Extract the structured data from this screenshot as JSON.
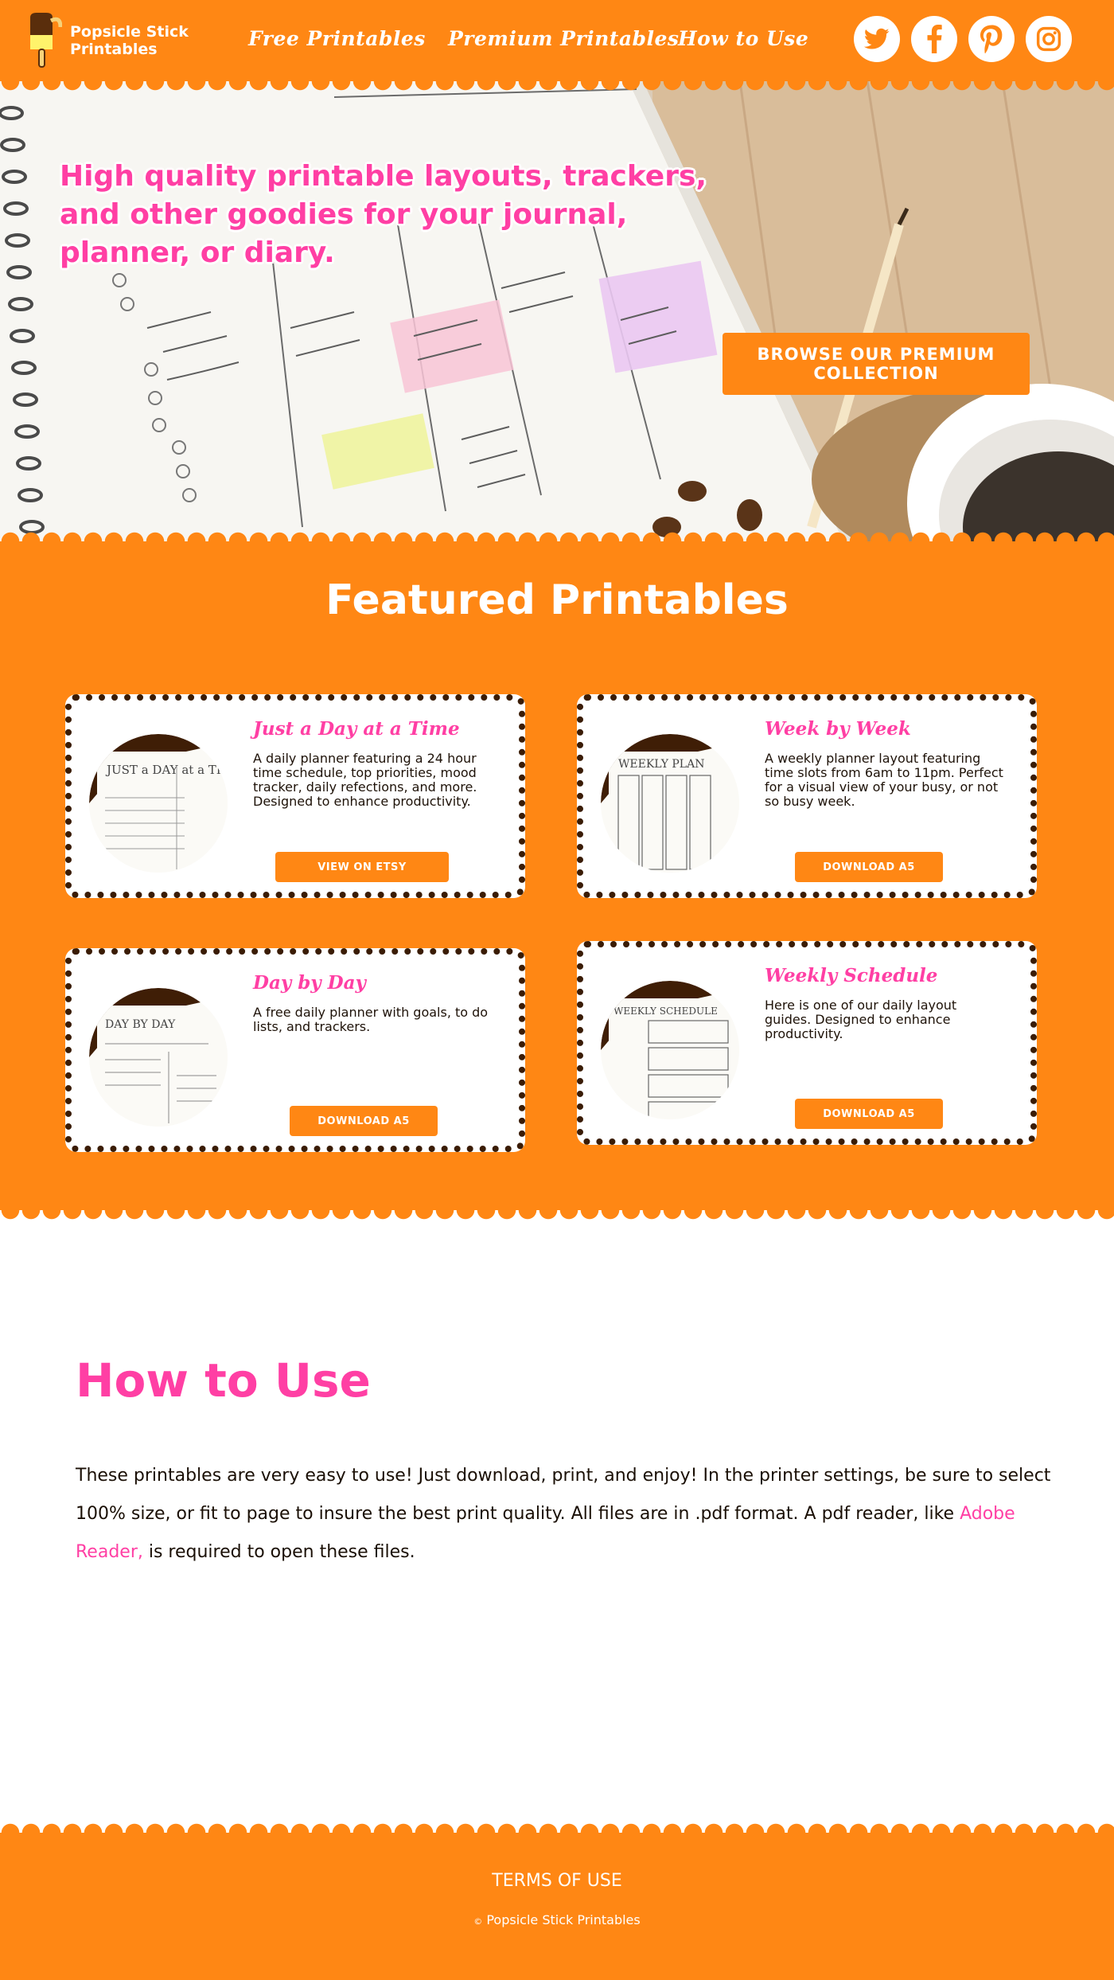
{
  "header": {
    "logo_line1": "Popsicle Stick",
    "logo_line2": "Printables",
    "nav": [
      "Free Printables",
      "Premium Printables",
      "How to Use"
    ],
    "social_icons": [
      "twitter-icon",
      "facebook-icon",
      "pinterest-icon",
      "instagram-icon"
    ]
  },
  "hero": {
    "title": "High quality printable layouts, trackers, and other goodies for your journal, planner, or diary.",
    "button": "BROWSE OUR PREMIUM COLLECTION"
  },
  "featured": {
    "title": "Featured Printables",
    "cards": [
      {
        "title": "Just a Day at a Time",
        "description": "A daily planner featuring a 24 hour time schedule, top priorities, mood tracker, daily refections, and more. Designed to enhance productivity.",
        "button": "VIEW ON ETSY",
        "thumb_label": "JUST a DAY at a TIME"
      },
      {
        "title": "Week by Week",
        "description": "A weekly planner layout featuring time slots from 6am to 11pm. Perfect for a visual view of your busy, or not so busy week.",
        "button": "DOWNLOAD A5",
        "thumb_label": "WEEKLY PLAN"
      },
      {
        "title": "Day by Day",
        "description": "A free daily planner with goals, to do lists, and trackers.",
        "button": "DOWNLOAD A5",
        "thumb_label": "DAY BY DAY"
      },
      {
        "title": "Weekly  Schedule",
        "description": "Here is one of our daily layout guides. Designed to enhance productivity.",
        "button": "DOWNLOAD A5",
        "thumb_label": "WEEKLY SCHEDULE"
      }
    ]
  },
  "how_to_use": {
    "title": "How to Use",
    "text_before_link": "These printables are very easy to use! Just download, print, and enjoy! In the printer settings, be sure to select 100% size, or fit to page to insure the best print quality. All files are in .pdf format. A pdf reader, like ",
    "link_text": "Adobe Reader,",
    "text_after_link": " is required to open these files."
  },
  "footer": {
    "terms": "TERMS OF USE",
    "copyright_symbol": "©",
    "copyright": "Popsicle Stick Printables"
  },
  "colors": {
    "brand_orange": "#ff8714",
    "accent_pink": "#ff3fa4",
    "dark_brown": "#3a1c05"
  }
}
